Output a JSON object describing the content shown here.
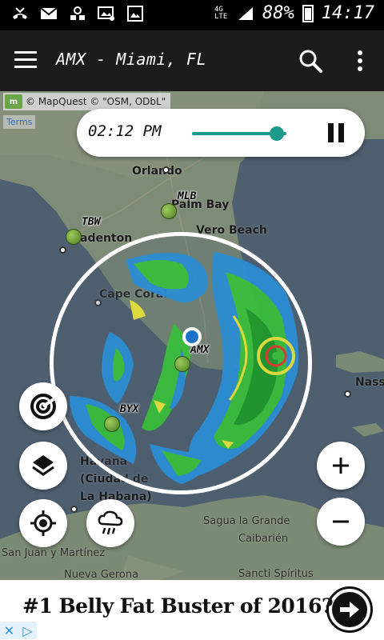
{
  "status_bar": {
    "network": "4G LTE",
    "battery": "88%",
    "time": "14:17",
    "icons": [
      "missed-call-icon",
      "email-icon",
      "mobile-data-icon",
      "mms-icon",
      "image-icon",
      "signal-icon",
      "battery-icon"
    ]
  },
  "app_bar": {
    "title": "AMX - Miami, FL",
    "menu_icon": "menu-icon",
    "search_icon": "search-icon",
    "more_icon": "more-vert-icon"
  },
  "map": {
    "attribution": "© MapQuest © \"OSM, ODbL\"",
    "terms_label": "Terms",
    "places": {
      "orlando": "Orlando",
      "palm_bay": "Palm Bay",
      "vero_beach": "Vero Beach",
      "bradenton": "adenton",
      "cape_coral": "Cape Coral",
      "nassau": "Nass",
      "havana": "Havana\n(Ciudad de\nLa Habana)",
      "sagua": "Sagua la Grande",
      "caibarien": "Caibarién",
      "san_juan": "San Juan y Martínez",
      "nueva_gerona": "Nueva Gerona",
      "sancti": "Sancti Spíritus"
    },
    "stations": {
      "mlb": "MLB",
      "tbw": "TBW",
      "amx": "AMX",
      "byx": "BYX"
    }
  },
  "playback": {
    "time": "02:12 PM",
    "progress": 0.9,
    "accent_color": "#1a9a8b"
  },
  "fabs": {
    "radar": "radar-icon",
    "layers": "layers-icon",
    "locate": "my-location-icon",
    "weather": "cloud-rain-icon",
    "zoom_in": "+",
    "zoom_out": "−"
  },
  "ad": {
    "headline": "#1 Belly Fat Buster of 2016?",
    "arrow_icon": "arrow-right-icon",
    "adchoices": [
      "✕",
      "▷"
    ]
  }
}
